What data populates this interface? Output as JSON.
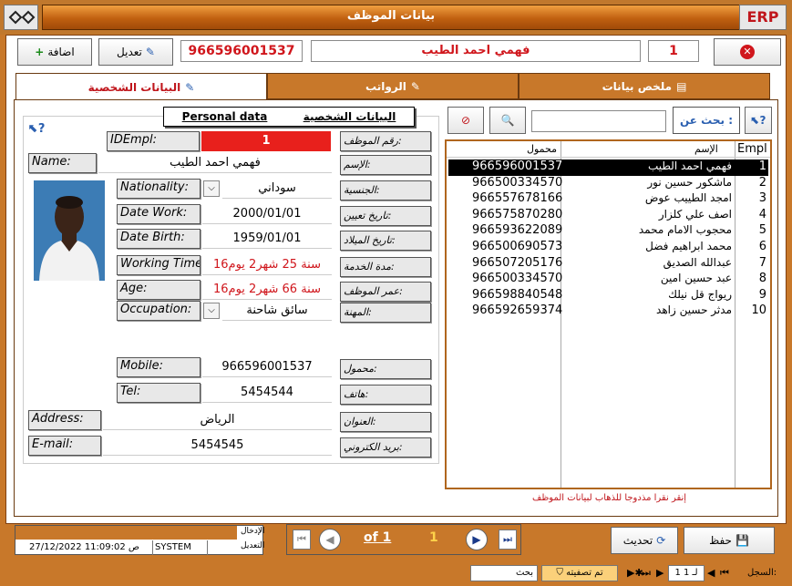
{
  "window": {
    "title": "بيانات الموظف",
    "erp_label": "ERP"
  },
  "toolbar": {
    "add_label": "اضافة",
    "edit_label": "تعديل",
    "mobile_display": "966596001537",
    "name_display": "فهمي احمد الطيب",
    "id_display": "1"
  },
  "tabs": [
    {
      "label": "البيانات الشخصية"
    },
    {
      "label": "الرواتب"
    },
    {
      "label": "ملخص بيانات"
    }
  ],
  "form": {
    "header_ar": "البيانات الشخصية",
    "header_en": "Personal data",
    "id_label": "IDEmpl:",
    "id_value": "1",
    "id_label_ar": "رقم الموظف:",
    "name_label": "Name:",
    "name_value": "فهمي احمد الطيب",
    "name_label_ar": "الإسم:",
    "nationality_label": "Nationality:",
    "nationality_value": "سوداني",
    "nationality_label_ar": "الجنسية:",
    "datework_label": "Date Work:",
    "datework_value": "2000/01/01",
    "datework_label_ar": "تاريخ تعيين:",
    "datebirth_label": "Date Birth:",
    "datebirth_value": "1959/01/01",
    "datebirth_label_ar": "تاريخ الميلاد:",
    "workingtime_label": "Working Time:",
    "workingtime_value": "سنة 25 شهر2 يوم16",
    "workingtime_label_ar": "مدة الخدمة:",
    "age_label": "Age:",
    "age_value": "سنة 66 شهر2 يوم16",
    "age_label_ar": "عمر الموظف:",
    "occupation_label": "Occupation:",
    "occupation_value": "سائق شاحنة",
    "occupation_label_ar": "المهنة:",
    "mobile_label": "Mobile:",
    "mobile_value": "966596001537",
    "mobile_label_ar": "محمول:",
    "tel_label": "Tel:",
    "tel_value": "5454544",
    "tel_label_ar": "هاتف:",
    "address_label": "Address:",
    "address_value": "الرياض",
    "address_label_ar": "العنوان:",
    "email_label": "E-mail:",
    "email_value": "5454545",
    "email_label_ar": "بريد الكتروني:"
  },
  "search": {
    "label": "بحث عن :",
    "value": ""
  },
  "list": {
    "col_mobile": "محمول",
    "col_name": "الإسم",
    "col_id": "Empl",
    "rows": [
      {
        "id": "1",
        "name": "فهمي احمد الطيب",
        "mobile": "966596001537"
      },
      {
        "id": "2",
        "name": "ماشكور حسين نور",
        "mobile": "966500334570"
      },
      {
        "id": "3",
        "name": "امجد الطييب عوض",
        "mobile": "966557678166"
      },
      {
        "id": "4",
        "name": "اصف علي كلزار",
        "mobile": "966575870280"
      },
      {
        "id": "5",
        "name": "محجوب الامام محمد",
        "mobile": "966593622089"
      },
      {
        "id": "6",
        "name": "محمد ابراهيم فضل",
        "mobile": "966500690573"
      },
      {
        "id": "7",
        "name": "عبدالله الصديق",
        "mobile": "966507205176"
      },
      {
        "id": "8",
        "name": "عبد حسين امين",
        "mobile": "966500334570"
      },
      {
        "id": "9",
        "name": "ريواج قل نيلك",
        "mobile": "966598840548"
      },
      {
        "id": "10",
        "name": "مدثر حسين زاهد",
        "mobile": "966592659374"
      }
    ],
    "hint": "إنقر نقرا مذدوجا للذهاب لبيانات الموظف"
  },
  "audit": {
    "entry_label": "الإدخال",
    "edit_label": "التعديل",
    "user": "SYSTEM",
    "datetime": "27/12/2022 11:09:02 ص"
  },
  "pager": {
    "of_label": "of 1",
    "current": "1"
  },
  "actions": {
    "refresh_label": "تحديث",
    "save_label": "حفظ"
  },
  "statusbar": {
    "record_label": "السجل:",
    "record_value": "1 لـ 1",
    "filter_label": "تم تصفيته",
    "search_label": "بحث"
  }
}
